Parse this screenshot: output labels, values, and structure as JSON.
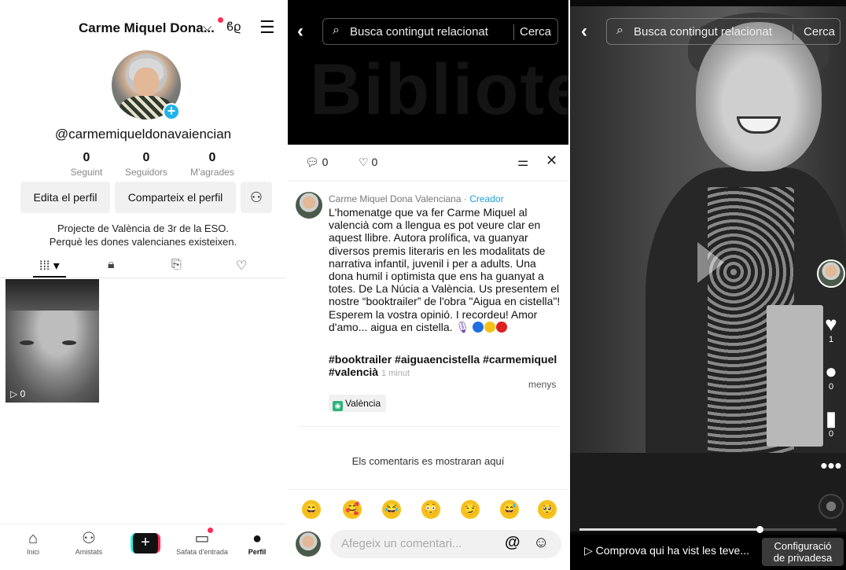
{
  "profile": {
    "display_name": "Carme Miquel Dona...",
    "handle": "@carmemiqueldonavaiencian",
    "stats": [
      {
        "value": "0",
        "label": "Seguint"
      },
      {
        "value": "0",
        "label": "Seguidors"
      },
      {
        "value": "0",
        "label": "M'agrades"
      }
    ],
    "edit_button": "Edita el perfil",
    "share_button": "Comparteix el perfil",
    "bio_line1": "Projecte de València de 3r de la ESO.",
    "bio_line2": "Perquè les dones valencianes existeixen.",
    "video_views": "▷ 0",
    "nav": [
      {
        "label": "Inici",
        "icon": "home-icon"
      },
      {
        "label": "Amistats",
        "icon": "friends-icon"
      },
      {
        "label": "",
        "icon": "create-icon"
      },
      {
        "label": "Safata d'entrada",
        "icon": "inbox-icon"
      },
      {
        "label": "Perfil",
        "icon": "profile-icon"
      }
    ]
  },
  "comments_screen": {
    "search_placeholder": "Busca contingut relacionat",
    "search_button": "Cerca",
    "comment_count": "0",
    "like_count": "0",
    "author": "Carme Miquel Dona Valenciana",
    "author_separator": " · ",
    "author_badge": "Creador",
    "description": "L'homenatge que va fer Carme Miquel al valencià com a llengua es pot veure clar en aquest llibre. Autora prolífica, va guanyar diversos premis literaris en les modalitats de narrativa infantil, juvenil i per a adults. Una dona humil i optimista que ens ha guanyat a totes. De La Núcia a València. Us presentem el nostre “booktrailer” de l'obra \"Aigua en cistella\"! Esperem la vostra opinió. I recordeu! Amor d'amo... aigua en cistella.",
    "hashtags": "#booktrailer #aiguaencistella #carmemiquel #valencià",
    "time_ago": "1 minut",
    "less_link": "menys",
    "location": "València",
    "empty_message": "Els comentaris es mostraran aquí",
    "quick_emojis": [
      "😄",
      "🥰",
      "😂",
      "😳",
      "😏",
      "😅",
      "🥺"
    ],
    "input_placeholder": "Afegeix un comentari...",
    "input_at": "@",
    "input_emoji": "☺"
  },
  "video_screen": {
    "search_placeholder": "Busca contingut relacionat",
    "search_button": "Cerca",
    "likes": "1",
    "comments": "0",
    "saves": "0",
    "progress_fraction": 0.7,
    "who_viewed": "Comprova qui ha vist les teve...",
    "privacy_line1": "Configuració",
    "privacy_line2": "de privadesa"
  },
  "colors": {
    "accent_pink": "#fe2c55",
    "accent_cyan": "#25f4ee",
    "badge_blue": "#20a0d8"
  }
}
